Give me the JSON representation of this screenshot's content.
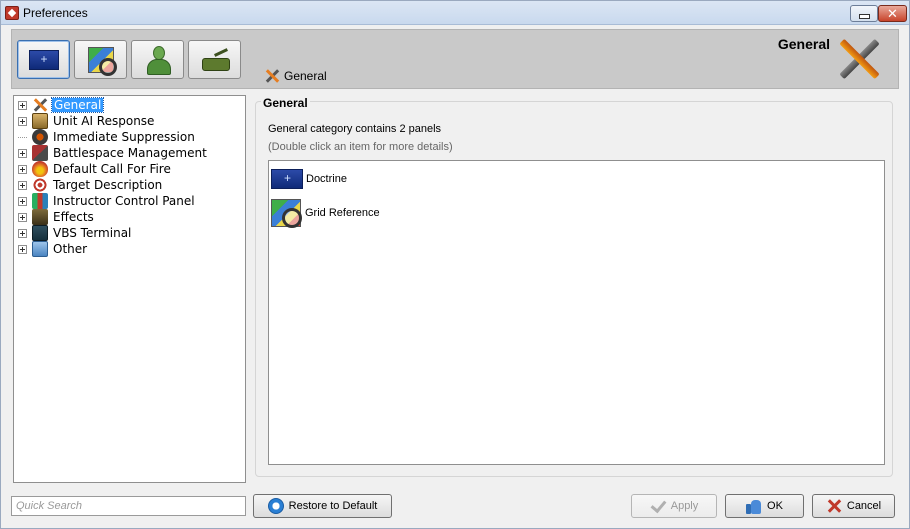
{
  "window": {
    "title": "Preferences",
    "close_glyph": "✕"
  },
  "toolbar": {
    "buttons": [
      {
        "name": "doctrine",
        "icon": "doctrine-icon"
      },
      {
        "name": "grid-reference",
        "icon": "grid-map-icon"
      },
      {
        "name": "user",
        "icon": "user-icon"
      },
      {
        "name": "tank",
        "icon": "tank-icon"
      }
    ]
  },
  "header": {
    "title": "General",
    "crumb": "General",
    "icon": "tools-icon"
  },
  "tree": {
    "items": [
      {
        "label": "General",
        "icon": "tools-icon",
        "expandable": true,
        "selected": true
      },
      {
        "label": "Unit AI Response",
        "icon": "unit-ai-icon",
        "expandable": true
      },
      {
        "label": "Immediate Suppression",
        "icon": "suppression-icon",
        "expandable": false
      },
      {
        "label": "Battlespace Management",
        "icon": "battlespace-icon",
        "expandable": true
      },
      {
        "label": "Default Call For Fire",
        "icon": "fire-icon",
        "expandable": true
      },
      {
        "label": "Target Description",
        "icon": "target-icon",
        "expandable": true
      },
      {
        "label": "Instructor Control Panel",
        "icon": "instructor-icon",
        "expandable": true
      },
      {
        "label": "Effects",
        "icon": "effects-icon",
        "expandable": true
      },
      {
        "label": "VBS Terminal",
        "icon": "terminal-icon",
        "expandable": true
      },
      {
        "label": "Other",
        "icon": "other-icon",
        "expandable": true
      }
    ]
  },
  "content": {
    "group_title": "General",
    "description": "General category contains 2 panels",
    "hint": "(Double click an item for more details)",
    "panels": [
      {
        "label": "Doctrine",
        "icon": "doctrine-icon"
      },
      {
        "label": "Grid Reference",
        "icon": "grid-map-icon"
      }
    ]
  },
  "footer": {
    "search_placeholder": "Quick Search",
    "restore_label": "Restore to Default",
    "apply_label": "Apply",
    "ok_label": "OK",
    "cancel_label": "Cancel"
  },
  "colors": {
    "selection": "#3399ff",
    "header_band": "#c9c9c9",
    "window_bg": "#f0f0f0"
  }
}
